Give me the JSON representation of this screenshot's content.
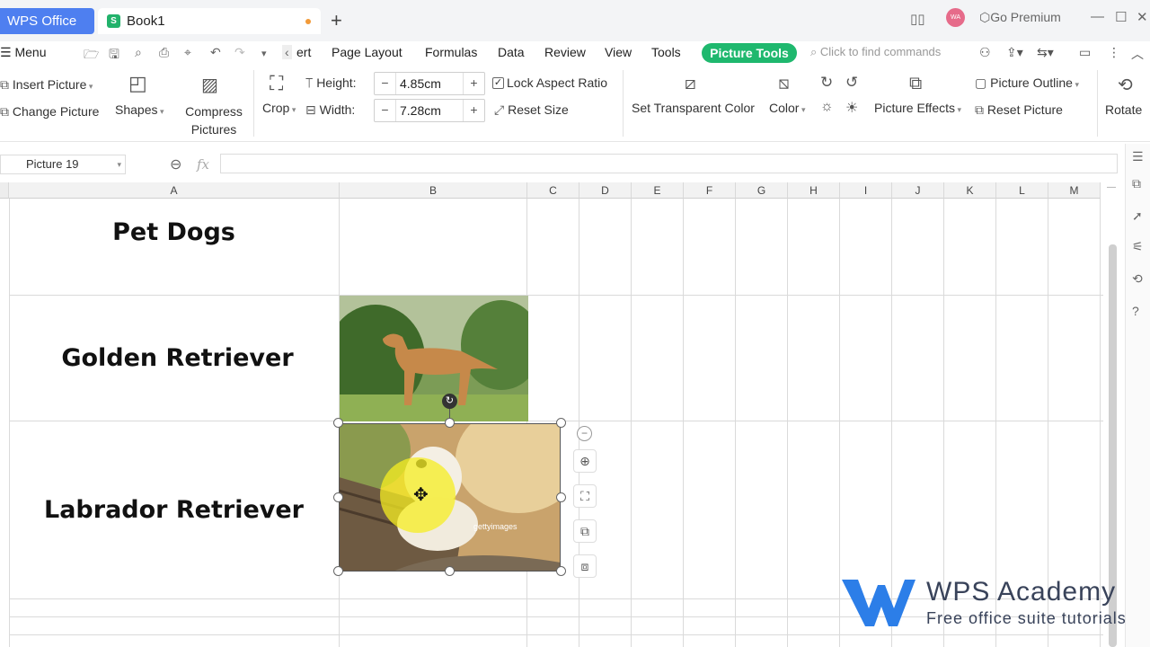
{
  "titlebar": {
    "app_tab": "WPS Office",
    "doc_tab": "Book1",
    "avatar_initials": "WA",
    "go_premium": "Go Premium",
    "accent_color": "#4e7ff0"
  },
  "menubar": {
    "menu_label": "Menu",
    "tabs": [
      "ert",
      "Page Layout",
      "Formulas",
      "Data",
      "Review",
      "View",
      "Tools"
    ],
    "active_tab": "Picture Tools",
    "search_placeholder": "Click to find commands",
    "active_color": "#1fb86e"
  },
  "ribbon": {
    "insert_picture": "Insert Picture",
    "change_picture": "Change Picture",
    "shapes": "Shapes",
    "compress_line1": "Compress",
    "compress_line2": "Pictures",
    "crop": "Crop",
    "height_label": "Height:",
    "height_value": "4.85cm",
    "width_label": "Width:",
    "width_value": "7.28cm",
    "lock_aspect": "Lock Aspect Ratio",
    "lock_aspect_checked": true,
    "reset_size": "Reset Size",
    "set_transparent": "Set Transparent Color",
    "color": "Color",
    "picture_effects": "Picture Effects",
    "picture_outline": "Picture Outline",
    "reset_picture": "Reset Picture",
    "rotate": "Rotate"
  },
  "formulabar": {
    "name_box": "Picture 19",
    "fx": "fx"
  },
  "sheet": {
    "columns": [
      "A",
      "B",
      "C",
      "D",
      "E",
      "F",
      "G",
      "H",
      "I",
      "J",
      "K",
      "L",
      "M"
    ],
    "cells": {
      "a1": "Pet Dogs",
      "a2": "Golden Retriever",
      "a3": "Labrador Retriever"
    },
    "image_watermark": "gettyimages"
  },
  "watermark": {
    "title": "WPS Academy",
    "subtitle": "Free office suite tutorials"
  }
}
